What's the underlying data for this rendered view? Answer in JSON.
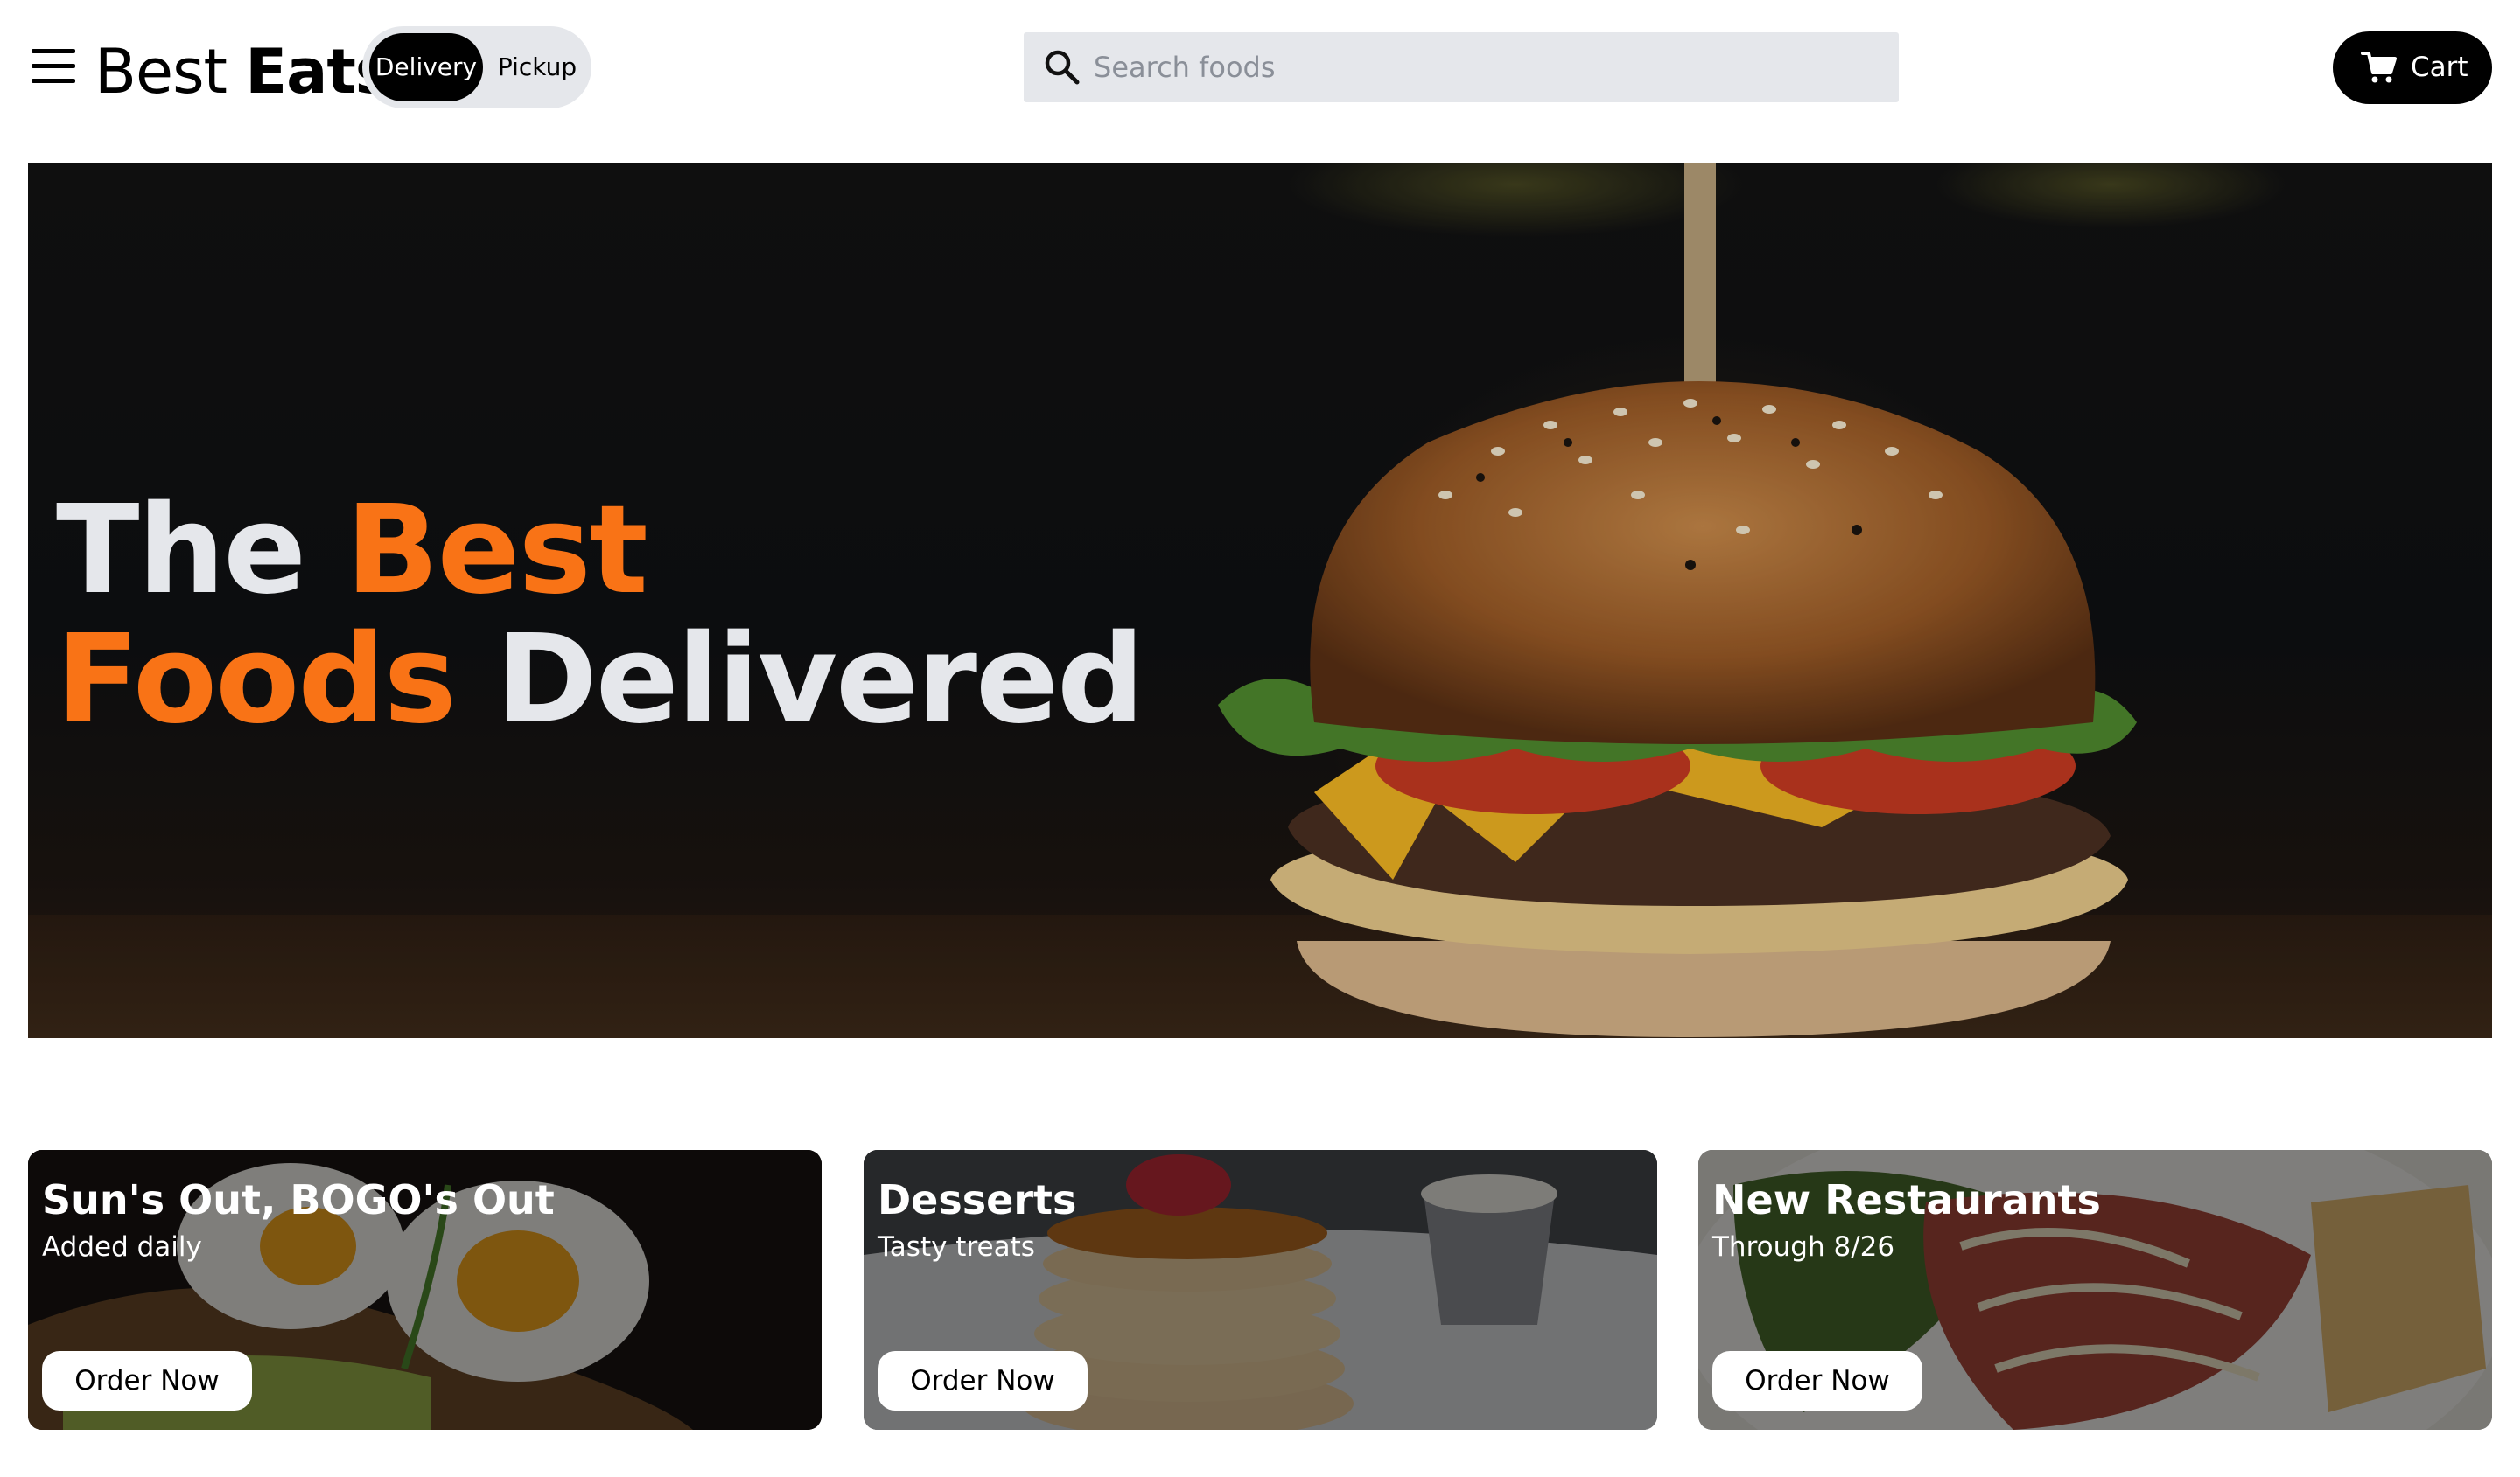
{
  "header": {
    "menu_icon": "hamburger-menu-icon",
    "logo": {
      "part1": "Best",
      "part2": "Eats"
    },
    "mode_toggle": {
      "delivery": "Delivery",
      "pickup": "Pickup",
      "selected": "Delivery"
    },
    "search": {
      "placeholder": "Search foods",
      "value": "",
      "icon": "search-icon"
    },
    "cart": {
      "label": "Cart",
      "icon": "cart-icon"
    }
  },
  "hero": {
    "title_word1": "The",
    "title_word2": "Best",
    "title_word3": "Foods",
    "title_word4": "Delivered",
    "accent_color": "#f97316",
    "text_color": "#e5e7eb"
  },
  "cards": [
    {
      "title": "Sun's Out, BOGO's Out",
      "subtitle": "Added daily",
      "button": "Order Now"
    },
    {
      "title": "Desserts",
      "subtitle": "Tasty treats",
      "button": "Order Now"
    },
    {
      "title": "New Restaurants",
      "subtitle": "Through 8/26",
      "button": "Order Now"
    }
  ],
  "colors": {
    "accent": "#f97316",
    "toggle_bg": "#e5e7eb",
    "search_bg": "#e5e7eb",
    "button_dark": "#000000"
  }
}
